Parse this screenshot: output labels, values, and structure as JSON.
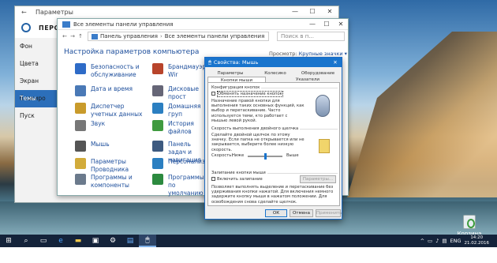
{
  "settings": {
    "title": "Параметры",
    "header": "ПЕРСОН",
    "nav": [
      "Фон",
      "Цвета",
      "Экран блокиро",
      "Темы",
      "Пуск"
    ],
    "active_index": 3
  },
  "control_panel": {
    "title": "Все элементы панели управления",
    "breadcrumb": [
      "Панель управления",
      "Все элементы панели управления"
    ],
    "search_placeholder": "Поиск в п...",
    "heading": "Настройка параметров компьютера",
    "view_by_label": "Просмотр:",
    "view_by_value": "Крупные значки ▾",
    "items": [
      {
        "label": "Безопасность и обслуживание",
        "color": "#2e6bc7",
        "icon": "flag-icon"
      },
      {
        "label": "Брандмауэр Wir",
        "color": "#b8442b",
        "icon": "firewall-icon"
      },
      {
        "label": "Дата и время",
        "color": "#4a79b6",
        "icon": "clock-icon"
      },
      {
        "label": "Дисковые прост",
        "color": "#667",
        "icon": "disk-icon"
      },
      {
        "label": "Диспетчер учетных данных",
        "color": "#c99b2b",
        "icon": "credential-icon"
      },
      {
        "label": "Домашняя груп",
        "color": "#2b7fc1",
        "icon": "homegroup-icon"
      },
      {
        "label": "Звук",
        "color": "#777",
        "icon": "sound-icon"
      },
      {
        "label": "История файлов",
        "color": "#3f9a3f",
        "icon": "history-icon"
      },
      {
        "label": "Мышь",
        "color": "#555",
        "icon": "mouse-icon"
      },
      {
        "label": "Панель задач и навигация",
        "color": "#3d5a80",
        "icon": "taskbar-icon"
      },
      {
        "label": "Параметры Проводника",
        "color": "#d2ab3a",
        "icon": "folder-options-icon"
      },
      {
        "label": "Персонализация",
        "color": "#2b7fc1",
        "icon": "personalization-icon"
      },
      {
        "label": "Программы и компоненты",
        "color": "#6b7a8c",
        "icon": "programs-icon"
      },
      {
        "label": "Программы по умолчанию",
        "color": "#2c8a3f",
        "icon": "default-programs-icon"
      }
    ]
  },
  "mouse_dialog": {
    "title": "Свойства: Мышь",
    "tabs": [
      "Параметры указателя",
      "Колесико",
      "Оборудование",
      "Кнопки мыши",
      "Указатели"
    ],
    "active_tab": 3,
    "button_config": {
      "label": "Конфигурация кнопок",
      "checkbox": "Обменять назначение кнопок",
      "description": "Назначение правой кнопки для выполнения таких основных функций, как выбор и перетаскивание. Часто используется теми, кто работает с мышью левой рукой."
    },
    "double_click": {
      "label": "Скорость выполнения двойного щелчка",
      "description": "Сделайте двойной щелчок по этому значку. Если папка не открывается или не закрывается, выберите более низкую скорость.",
      "speed_label": "Скорость:",
      "low": "Ниже",
      "high": "Выше",
      "speed_fraction": 0.5
    },
    "click_lock": {
      "label": "Залипание кнопки мыши",
      "checkbox": "Включить залипание",
      "params_button": "Параметры...",
      "description": "Позволяет выполнять выделение и перетаскивание без удерживания кнопки нажатой. Для включения немного задержите кнопку мыши в нажатом положении. Для освобождения снова сделайте щелчок."
    },
    "ok": "ОК",
    "cancel": "Отмена",
    "apply": "Применить"
  },
  "taskbar": {
    "time": "14:20",
    "date": "21.02.2016",
    "lang": "ENG"
  },
  "desktop": {
    "recycle_label": "Корзина"
  }
}
